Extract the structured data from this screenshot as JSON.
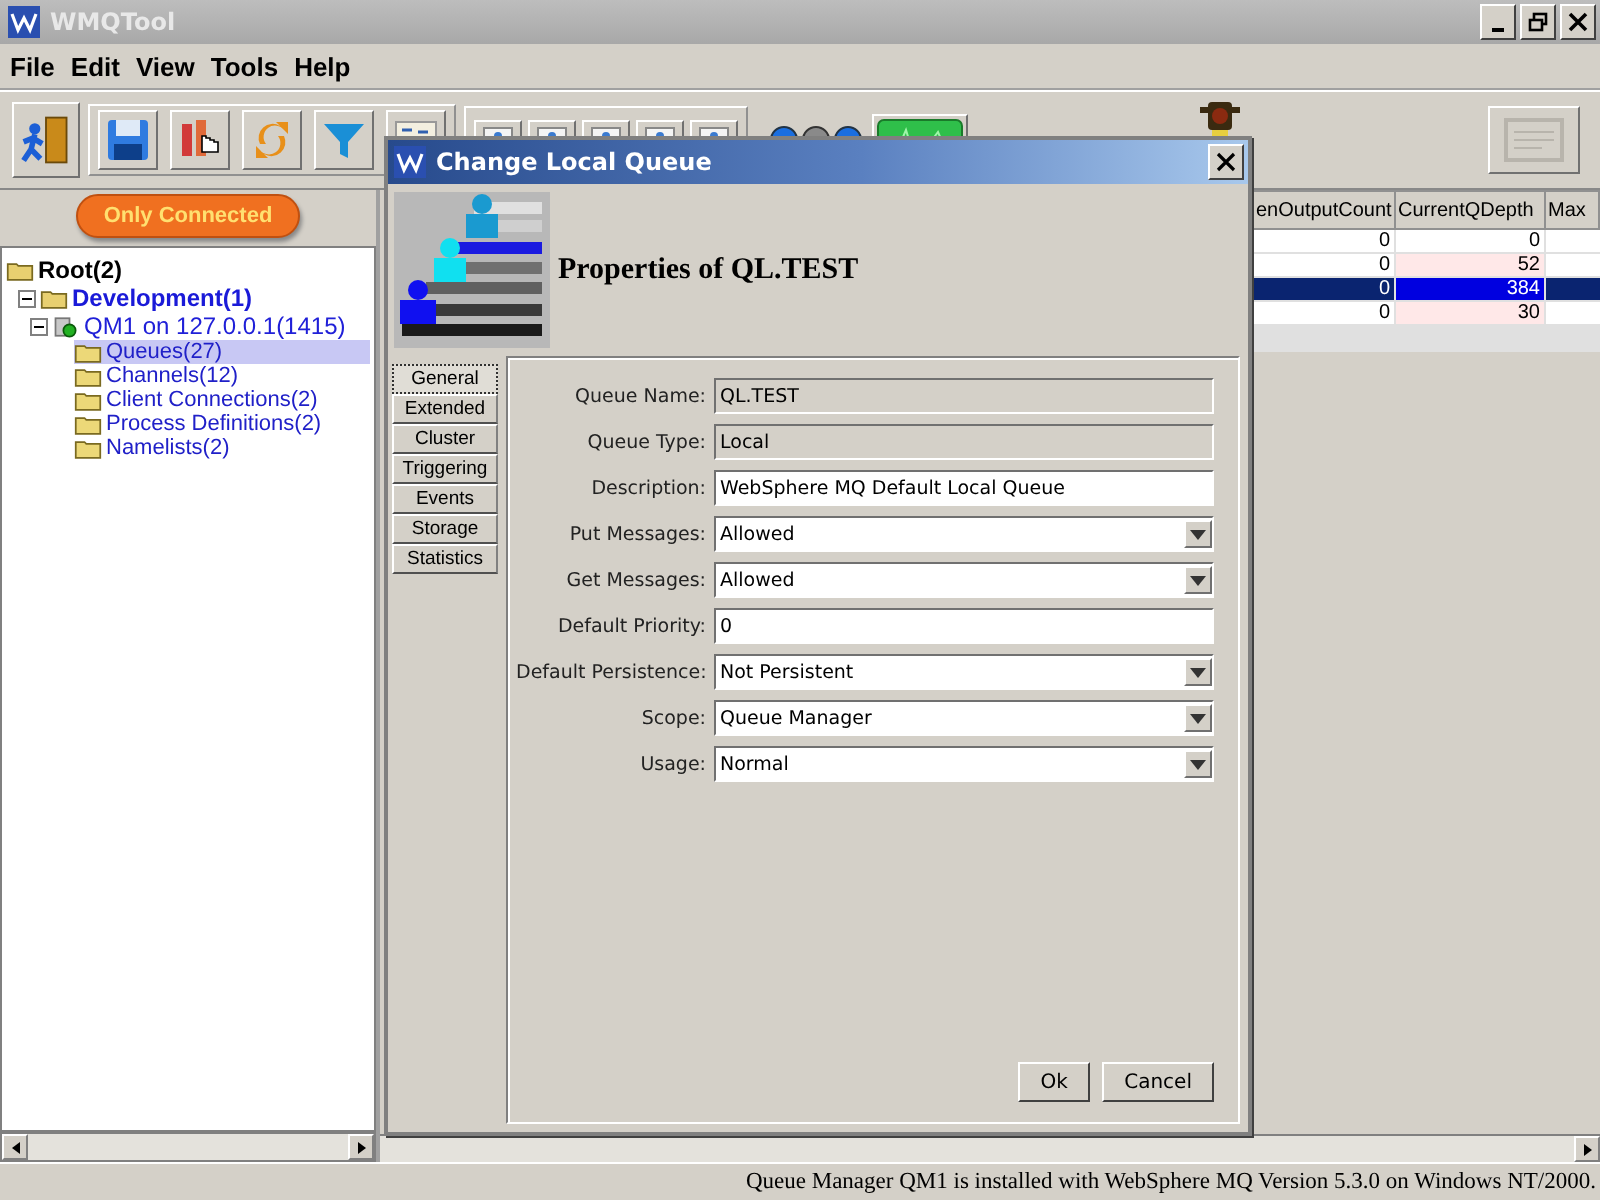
{
  "window": {
    "title": "WMQTool"
  },
  "menu": [
    "File",
    "Edit",
    "View",
    "Tools",
    "Help"
  ],
  "filter_button": {
    "label": "Only Connected"
  },
  "tree": [
    {
      "label": "Root(2)",
      "kind": "root",
      "selected": false,
      "children": [
        {
          "label": "Development(1)",
          "kind": "group",
          "selected": false,
          "expanded": true,
          "children": [
            {
              "label": "QM1  on 127.0.0.1(1415)",
              "kind": "manager",
              "selected": false,
              "expanded": true,
              "children": [
                {
                  "label": "Queues(27)",
                  "kind": "folder",
                  "selected": true
                },
                {
                  "label": "Channels(12)",
                  "kind": "folder",
                  "selected": false
                },
                {
                  "label": "Client Connections(2)",
                  "kind": "folder",
                  "selected": false
                },
                {
                  "label": "Process Definitions(2)",
                  "kind": "folder",
                  "selected": false
                },
                {
                  "label": "Namelists(2)",
                  "kind": "folder",
                  "selected": false
                }
              ]
            }
          ]
        }
      ]
    }
  ],
  "table": {
    "columns": [
      "enOutputCount",
      "CurrentQDepth",
      "Max"
    ],
    "rows": [
      {
        "cells": [
          "0",
          "0"
        ],
        "selected": false,
        "flagged": false
      },
      {
        "cells": [
          "0",
          "52"
        ],
        "selected": false,
        "flagged": true
      },
      {
        "cells": [
          "0",
          "384"
        ],
        "selected": true,
        "flagged": false
      },
      {
        "cells": [
          "0",
          "30"
        ],
        "selected": false,
        "flagged": true
      }
    ]
  },
  "dialog": {
    "title": "Change Local Queue",
    "heading": "Properties of QL.TEST",
    "tabs": [
      {
        "label": "General",
        "selected": true
      },
      {
        "label": "Extended",
        "selected": false
      },
      {
        "label": "Cluster",
        "selected": false
      },
      {
        "label": "Triggering",
        "selected": false
      },
      {
        "label": "Events",
        "selected": false
      },
      {
        "label": "Storage",
        "selected": false
      },
      {
        "label": "Statistics",
        "selected": false
      }
    ],
    "fields": [
      {
        "label": "Queue Name:",
        "value": "QL.TEST",
        "kind": "readonly"
      },
      {
        "label": "Queue Type:",
        "value": "Local",
        "kind": "readonly"
      },
      {
        "label": "Description:",
        "value": "WebSphere MQ Default Local Queue",
        "kind": "text"
      },
      {
        "label": "Put Messages:",
        "value": "Allowed",
        "kind": "select"
      },
      {
        "label": "Get Messages:",
        "value": "Allowed",
        "kind": "select"
      },
      {
        "label": "Default Priority:",
        "value": "0",
        "kind": "text"
      },
      {
        "label": "Default Persistence:",
        "value": "Not Persistent",
        "kind": "select"
      },
      {
        "label": "Scope:",
        "value": "Queue Manager",
        "kind": "select"
      },
      {
        "label": "Usage:",
        "value": "Normal",
        "kind": "select"
      }
    ],
    "buttons": [
      "Ok",
      "Cancel"
    ]
  },
  "status_bar": "Queue Manager QM1  is installed with WebSphere MQ Version 5.3.0 on Windows NT/2000."
}
